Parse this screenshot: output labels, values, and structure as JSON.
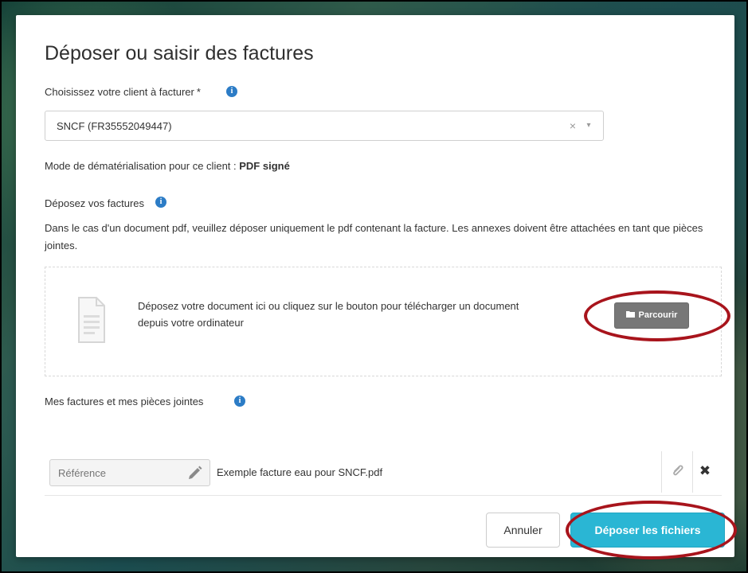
{
  "modal": {
    "title": "Déposer ou saisir des factures",
    "client_field": {
      "label": "Choisissez votre client à facturer",
      "required_marker": "*",
      "value": "SNCF (FR35552049447)",
      "clear_symbol": "×",
      "caret_symbol": "▾"
    },
    "dematerialisation": {
      "label": "Mode de dématérialisation pour ce client : ",
      "value": "PDF signé"
    },
    "upload_section": {
      "label": "Déposez vos factures",
      "hint": "Dans le cas d'un document pdf, veuillez déposer uniquement le pdf contenant la facture. Les annexes doivent être attachées en tant que pièces jointes.",
      "dropzone_text": "Déposez votre document ici ou cliquez sur le bouton pour télécharger un document depuis votre ordinateur",
      "browse_button_label": "Parcourir"
    },
    "attachments": {
      "label": "Mes factures et mes pièces jointes",
      "rows": [
        {
          "reference_placeholder": "Référence",
          "file_name": "Exemple facture eau pour SNCF.pdf",
          "delete_symbol": "✖"
        }
      ]
    },
    "footer": {
      "cancel_label": "Annuler",
      "submit_label": "Déposer les fichiers"
    }
  },
  "icons": {
    "info": "info-icon",
    "clear": "clear-icon",
    "caret": "chevron-down-icon",
    "document": "document-icon",
    "folder": "folder-icon",
    "pencil": "pencil-icon",
    "attachment": "paperclip-icon",
    "delete": "close-icon"
  },
  "colors": {
    "info_icon": "#2c7cc6",
    "browse_button": "#777777",
    "submit_button": "#2ab6d4",
    "highlight_ellipse": "#a8141c"
  }
}
